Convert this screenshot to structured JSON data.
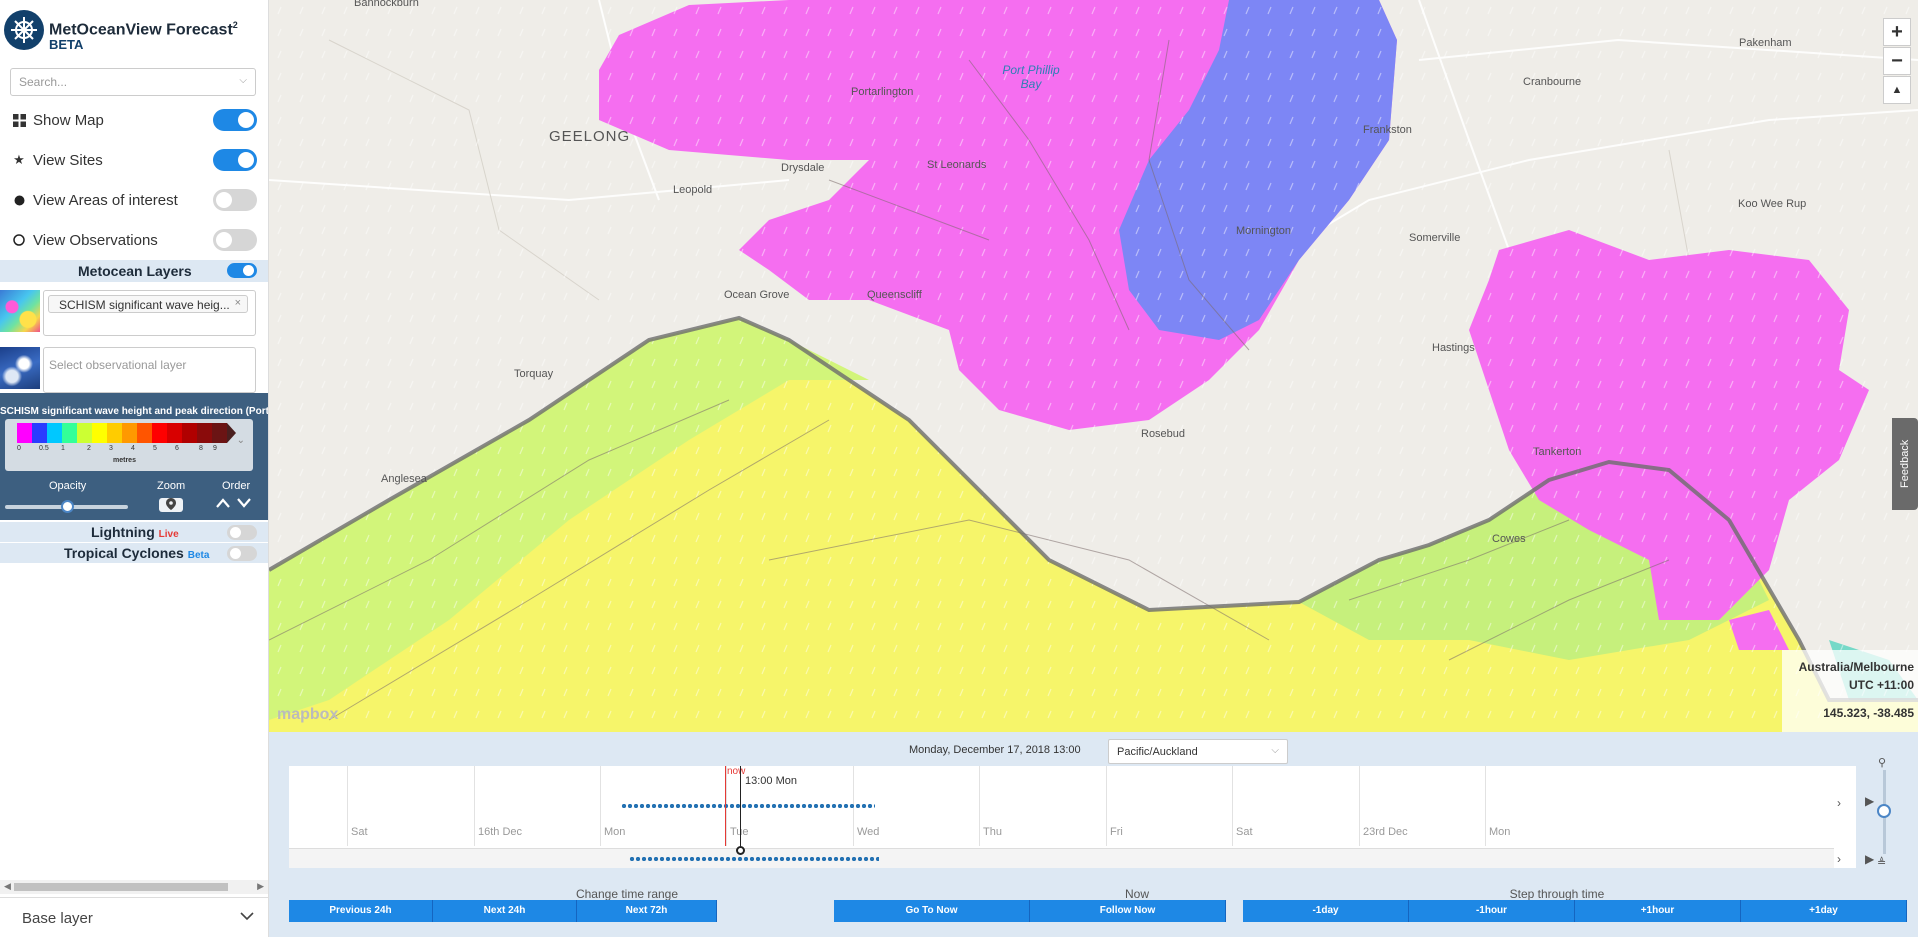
{
  "brand": {
    "title": "MetOceanView Forecast",
    "superscript": "2",
    "subtitle": "BETA"
  },
  "search": {
    "placeholder": "Search..."
  },
  "toggles": [
    {
      "label": "Show Map",
      "icon": "grid-icon",
      "on": true
    },
    {
      "label": "View Sites",
      "icon": "star-icon",
      "on": true
    },
    {
      "label": "View Areas of interest",
      "icon": "filled-circle-icon",
      "on": false
    },
    {
      "label": "View Observations",
      "icon": "hollow-circle-icon",
      "on": false
    }
  ],
  "metocean": {
    "header": "Metocean Layers",
    "active_layer_chip": "SCHISM significant wave heig...",
    "chip_close": "×",
    "observational_placeholder": "Select observational layer"
  },
  "legend": {
    "title": "SCHISM significant wave height and peak direction (Port Phill",
    "ticks": [
      "0",
      "0.5",
      "1",
      "2",
      "3",
      "4",
      "5",
      "6",
      "8",
      "9"
    ],
    "unit": "metres",
    "colors": [
      "#ff00ff",
      "#2a3cff",
      "#00c8ff",
      "#33ff99",
      "#ccff33",
      "#ffff00",
      "#ffcc00",
      "#ff9900",
      "#ff5500",
      "#ff0000",
      "#d80000",
      "#b00000",
      "#8a0b0b",
      "#6b1414"
    ],
    "opacity_label": "Opacity",
    "opacity_value": 0.48,
    "zoom_label": "Zoom",
    "order_label": "Order"
  },
  "extras": {
    "lightning": {
      "label": "Lightning",
      "tag": "Live"
    },
    "cyclones": {
      "label": "Tropical Cyclones",
      "tag": "Beta"
    }
  },
  "base_layer": {
    "label": "Base layer"
  },
  "map": {
    "places": {
      "bannockburn": "Bannockburn",
      "geelong": "GEELONG",
      "portarlington": "Portarlington",
      "port_phillip": "Port Phillip\nBay",
      "drysdale": "Drysdale",
      "leopold": "Leopold",
      "st_leonards": "St Leonards",
      "ocean_grove": "Ocean Grove",
      "queenscliff": "Queenscliff",
      "torquay": "Torquay",
      "anglesea": "Anglesea",
      "rosebud": "Rosebud",
      "frankston": "Frankston",
      "mornington": "Mornington",
      "cranbourne": "Cranbourne",
      "pakenham": "Pakenham",
      "somerville": "Somerville",
      "koo_wee_rup": "Koo Wee Rup",
      "hastings": "Hastings",
      "tankerton": "Tankerton",
      "cowes": "Cowes"
    },
    "controls": {
      "zoom_in": "+",
      "zoom_out": "−",
      "compass": "▲"
    },
    "feedback": "Feedback",
    "timezone": "Australia/Melbourne",
    "utc": "UTC +11:00",
    "coords": "145.323, -38.485",
    "attribution": "mapbox"
  },
  "timeline": {
    "current_date": "Monday, December 17, 2018 13:00",
    "timezone_select": "Pacific/Auckland",
    "now_marker": "now",
    "cursor_label": "13:00 Mon",
    "day_labels": [
      "Sat",
      "16th Dec",
      "Mon",
      "Tue",
      "Wed",
      "Thu",
      "Fri",
      "Sat",
      "23rd Dec",
      "Mon"
    ],
    "groups": {
      "range": {
        "label": "Change time range",
        "buttons": [
          "Previous 24h",
          "Next 24h",
          "Next 72h"
        ]
      },
      "now": {
        "label": "Now",
        "buttons": [
          "Go To Now",
          "Follow Now"
        ]
      },
      "step": {
        "label": "Step through time",
        "buttons": [
          "-1day",
          "-1hour",
          "+1hour",
          "+1day"
        ]
      }
    }
  }
}
